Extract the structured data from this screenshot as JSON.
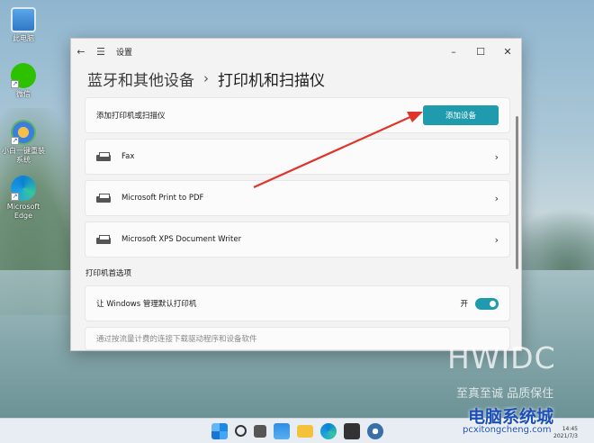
{
  "desktop": {
    "icons": [
      {
        "label": "此电脑",
        "icon": "this-pc-icon"
      },
      {
        "label": "微信",
        "icon": "wechat-icon"
      },
      {
        "label": "小白一键重装系统",
        "icon": "xiaobai-icon"
      },
      {
        "label": "Microsoft Edge",
        "icon": "edge-icon"
      }
    ]
  },
  "window": {
    "title": "设置",
    "breadcrumb": {
      "parent": "蓝牙和其他设备",
      "separator": "›",
      "current": "打印机和扫描仪"
    },
    "add_row": {
      "label": "添加打印机或扫描仪",
      "button": "添加设备"
    },
    "printers": [
      {
        "name": "Fax"
      },
      {
        "name": "Microsoft Print to PDF"
      },
      {
        "name": "Microsoft XPS Document Writer"
      }
    ],
    "preferences_title": "打印机首选项",
    "default_printer": {
      "label": "让 Windows 管理默认打印机",
      "state": "开",
      "on": true
    },
    "partial_row": "通过按流量计费的连接下载驱动程序和设备软件"
  },
  "taskbar": {
    "icons": [
      "start-icon",
      "search-icon",
      "task-view-icon",
      "widgets-icon",
      "file-explorer-icon",
      "edge-icon",
      "store-icon",
      "settings-icon"
    ],
    "time": "14:45",
    "date": "2021/7/3"
  },
  "watermark": {
    "brand": "HWIDC",
    "slogan": "至真至诚 品质保住",
    "site": "电脑系统城",
    "url": "pcxitongcheng.com"
  },
  "colors": {
    "accent": "#1f9bad",
    "annotation_arrow": "#e0342b"
  }
}
